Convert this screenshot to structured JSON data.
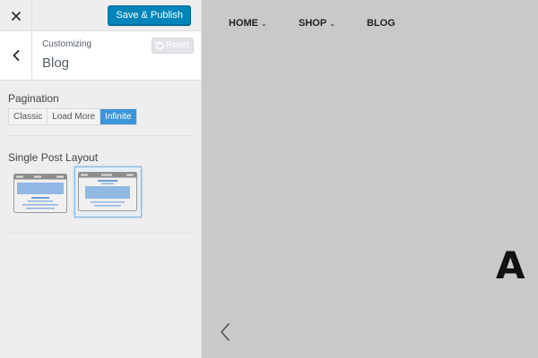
{
  "topbar": {
    "close_icon": "close-icon",
    "publish_label": "Save & Publish"
  },
  "section": {
    "back_icon": "chevron-left-icon",
    "subtitle": "Customizing",
    "title": "Blog",
    "reset_label": "Reset",
    "reset_icon": "undo-icon"
  },
  "pagination": {
    "label": "Pagination",
    "options": [
      "Classic",
      "Load More",
      "Infinite"
    ],
    "selected": "Infinite"
  },
  "single_post_layout": {
    "label": "Single Post Layout",
    "options": [
      "layout-1",
      "layout-2"
    ],
    "selected": "layout-2"
  },
  "preview": {
    "nav": [
      {
        "label": "HOME",
        "has_dropdown": true
      },
      {
        "label": "SHOP",
        "has_dropdown": true
      },
      {
        "label": "BLOG",
        "has_dropdown": false
      }
    ],
    "hero_text": "A T",
    "slider_prev_icon": "chevron-left-icon"
  },
  "colors": {
    "publish": "#0085ba",
    "active_option": "#3a95d9",
    "preview_bg": "#c9c9c9",
    "sidebar_bg": "#eeeeee"
  }
}
